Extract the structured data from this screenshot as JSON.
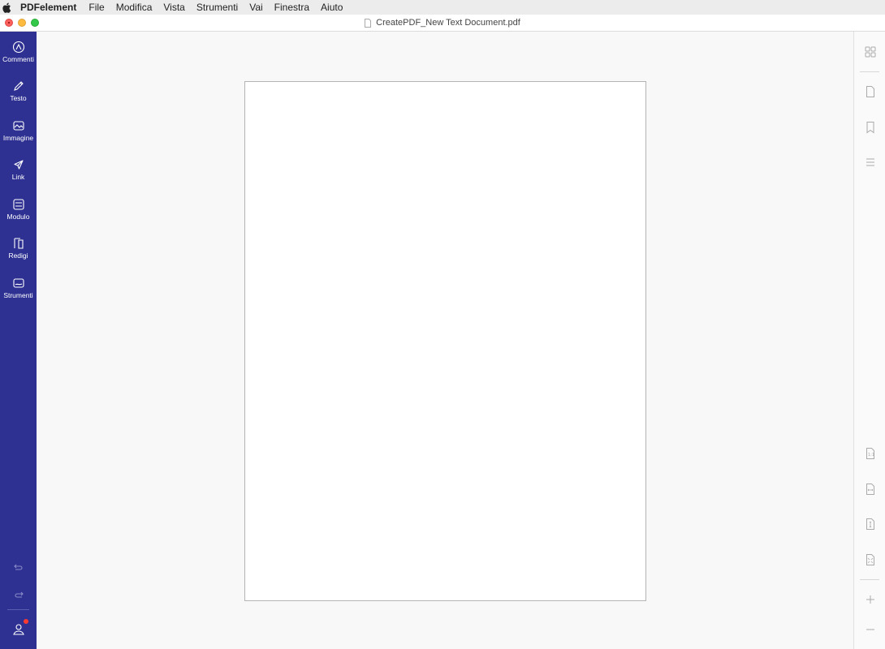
{
  "menubar": {
    "app_name": "PDFelement",
    "items": [
      "File",
      "Modifica",
      "Vista",
      "Strumenti",
      "Vai",
      "Finestra",
      "Aiuto"
    ]
  },
  "window": {
    "title": "CreatePDF_New Text Document.pdf"
  },
  "left_toolbar": {
    "items": [
      {
        "label": "Commenti",
        "icon": "comment-icon"
      },
      {
        "label": "Testo",
        "icon": "pencil-icon"
      },
      {
        "label": "Immagine",
        "icon": "image-icon"
      },
      {
        "label": "Link",
        "icon": "link-icon"
      },
      {
        "label": "Modulo",
        "icon": "form-icon"
      },
      {
        "label": "Redigi",
        "icon": "redact-icon"
      },
      {
        "label": "Strumenti",
        "icon": "tools-icon"
      }
    ],
    "bottom": [
      "undo-icon",
      "redo-icon",
      "account-icon"
    ]
  },
  "right_toolbar": {
    "icons": [
      "thumbnails-icon",
      "page-icon",
      "bookmark-icon",
      "outline-icon",
      "actual-size-icon",
      "fit-width-icon",
      "fit-page-icon",
      "full-screen-icon",
      "zoom-in-icon",
      "zoom-out-icon"
    ]
  },
  "colors": {
    "sidebar": "#2e3192",
    "notification": "#ff3b30"
  }
}
